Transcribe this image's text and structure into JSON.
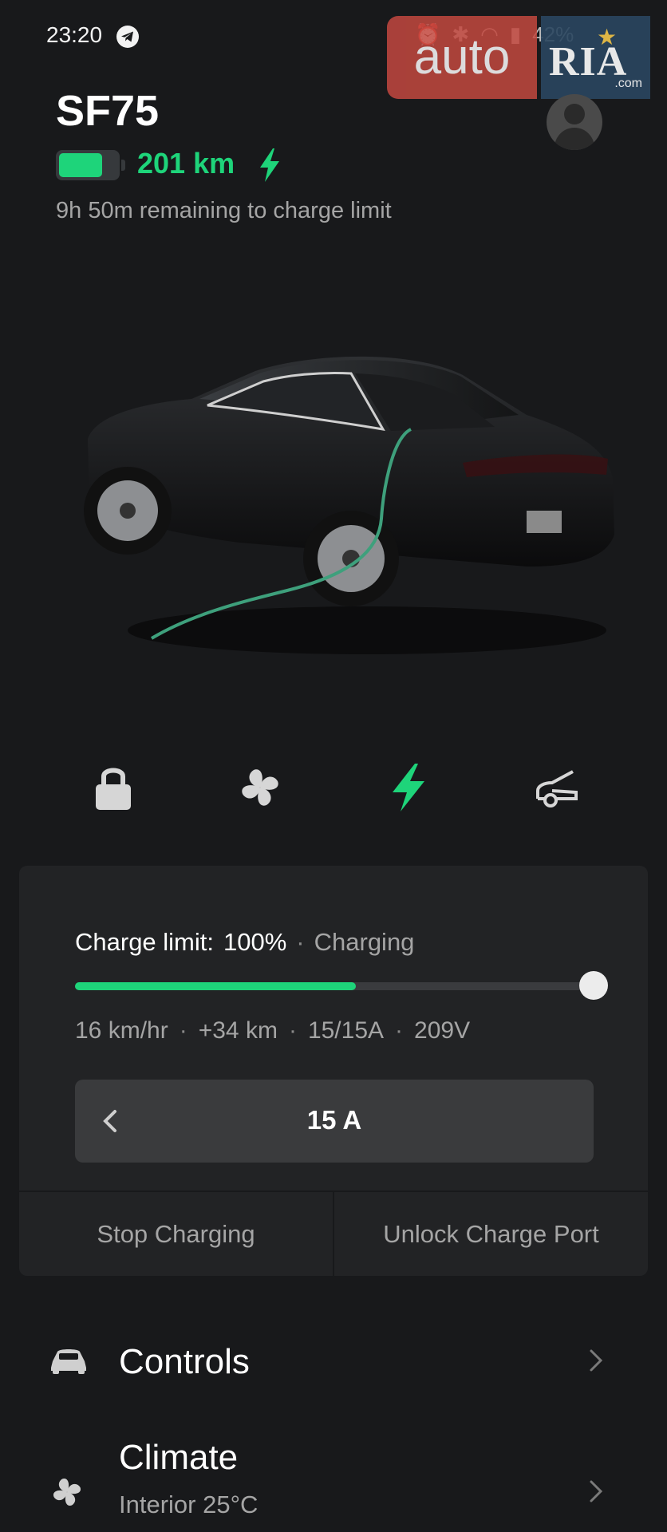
{
  "status_bar": {
    "time": "23:20",
    "battery_percent": "42%"
  },
  "watermark": {
    "auto": "auto",
    "ria": "RIA",
    "com": ".com"
  },
  "vehicle": {
    "name": "SF75",
    "range": "201 km",
    "battery_level": 0.75,
    "remaining": "9h 50m remaining to charge limit"
  },
  "quick_controls": [
    "lock",
    "fan",
    "charge",
    "frunk"
  ],
  "charging": {
    "limit_label": "Charge limit:",
    "limit_value": "100%",
    "status": "Charging",
    "current_level_fraction": 0.55,
    "stats": [
      "16 km/hr",
      "+34 km",
      "15/15A",
      "209V"
    ],
    "amps": "15 A",
    "stop_button": "Stop Charging",
    "unlock_button": "Unlock Charge Port"
  },
  "menu": {
    "controls_label": "Controls",
    "climate_label": "Climate",
    "climate_sub": "Interior 25°C"
  },
  "colors": {
    "accent": "#1ed47a",
    "background": "#18191b",
    "card": "#222325"
  },
  "icons": [
    "telegram-icon",
    "profile-icon",
    "battery-icon",
    "bolt-icon",
    "lock-icon",
    "fan-icon",
    "charge-icon",
    "frunk-icon",
    "chevron-left-icon",
    "car-icon",
    "chevron-right-icon"
  ]
}
